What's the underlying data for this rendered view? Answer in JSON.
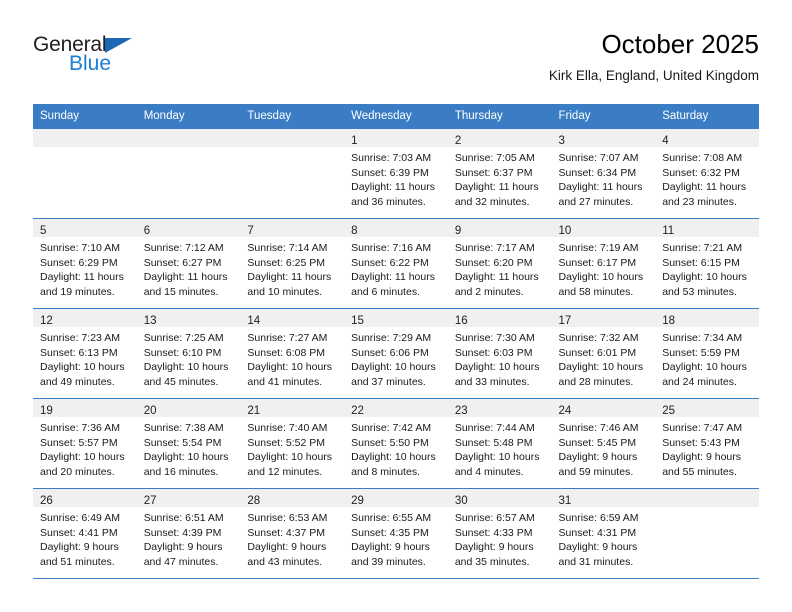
{
  "brand": {
    "name_top": "General",
    "name_bottom": "Blue",
    "accent_color": "#1b68b3",
    "blue_text_color": "#1b7fd4"
  },
  "header": {
    "title": "October 2025",
    "subtitle": "Kirk Ella, England, United Kingdom"
  },
  "theme": {
    "header_row_bg": "#3b7dc4",
    "header_row_text": "#ffffff",
    "daynum_band_bg": "#f0f0f0",
    "grid_line": "#3b7dc4"
  },
  "weekday_headers": [
    "Sunday",
    "Monday",
    "Tuesday",
    "Wednesday",
    "Thursday",
    "Friday",
    "Saturday"
  ],
  "weeks": [
    [
      {
        "day": "",
        "sunrise": "",
        "sunset": "",
        "daylight1": "",
        "daylight2": "",
        "empty": true
      },
      {
        "day": "",
        "sunrise": "",
        "sunset": "",
        "daylight1": "",
        "daylight2": "",
        "empty": true
      },
      {
        "day": "",
        "sunrise": "",
        "sunset": "",
        "daylight1": "",
        "daylight2": "",
        "empty": true
      },
      {
        "day": "1",
        "sunrise": "Sunrise: 7:03 AM",
        "sunset": "Sunset: 6:39 PM",
        "daylight1": "Daylight: 11 hours",
        "daylight2": "and 36 minutes.",
        "empty": false
      },
      {
        "day": "2",
        "sunrise": "Sunrise: 7:05 AM",
        "sunset": "Sunset: 6:37 PM",
        "daylight1": "Daylight: 11 hours",
        "daylight2": "and 32 minutes.",
        "empty": false
      },
      {
        "day": "3",
        "sunrise": "Sunrise: 7:07 AM",
        "sunset": "Sunset: 6:34 PM",
        "daylight1": "Daylight: 11 hours",
        "daylight2": "and 27 minutes.",
        "empty": false
      },
      {
        "day": "4",
        "sunrise": "Sunrise: 7:08 AM",
        "sunset": "Sunset: 6:32 PM",
        "daylight1": "Daylight: 11 hours",
        "daylight2": "and 23 minutes.",
        "empty": false
      }
    ],
    [
      {
        "day": "5",
        "sunrise": "Sunrise: 7:10 AM",
        "sunset": "Sunset: 6:29 PM",
        "daylight1": "Daylight: 11 hours",
        "daylight2": "and 19 minutes.",
        "empty": false
      },
      {
        "day": "6",
        "sunrise": "Sunrise: 7:12 AM",
        "sunset": "Sunset: 6:27 PM",
        "daylight1": "Daylight: 11 hours",
        "daylight2": "and 15 minutes.",
        "empty": false
      },
      {
        "day": "7",
        "sunrise": "Sunrise: 7:14 AM",
        "sunset": "Sunset: 6:25 PM",
        "daylight1": "Daylight: 11 hours",
        "daylight2": "and 10 minutes.",
        "empty": false
      },
      {
        "day": "8",
        "sunrise": "Sunrise: 7:16 AM",
        "sunset": "Sunset: 6:22 PM",
        "daylight1": "Daylight: 11 hours",
        "daylight2": "and 6 minutes.",
        "empty": false
      },
      {
        "day": "9",
        "sunrise": "Sunrise: 7:17 AM",
        "sunset": "Sunset: 6:20 PM",
        "daylight1": "Daylight: 11 hours",
        "daylight2": "and 2 minutes.",
        "empty": false
      },
      {
        "day": "10",
        "sunrise": "Sunrise: 7:19 AM",
        "sunset": "Sunset: 6:17 PM",
        "daylight1": "Daylight: 10 hours",
        "daylight2": "and 58 minutes.",
        "empty": false
      },
      {
        "day": "11",
        "sunrise": "Sunrise: 7:21 AM",
        "sunset": "Sunset: 6:15 PM",
        "daylight1": "Daylight: 10 hours",
        "daylight2": "and 53 minutes.",
        "empty": false
      }
    ],
    [
      {
        "day": "12",
        "sunrise": "Sunrise: 7:23 AM",
        "sunset": "Sunset: 6:13 PM",
        "daylight1": "Daylight: 10 hours",
        "daylight2": "and 49 minutes.",
        "empty": false
      },
      {
        "day": "13",
        "sunrise": "Sunrise: 7:25 AM",
        "sunset": "Sunset: 6:10 PM",
        "daylight1": "Daylight: 10 hours",
        "daylight2": "and 45 minutes.",
        "empty": false
      },
      {
        "day": "14",
        "sunrise": "Sunrise: 7:27 AM",
        "sunset": "Sunset: 6:08 PM",
        "daylight1": "Daylight: 10 hours",
        "daylight2": "and 41 minutes.",
        "empty": false
      },
      {
        "day": "15",
        "sunrise": "Sunrise: 7:29 AM",
        "sunset": "Sunset: 6:06 PM",
        "daylight1": "Daylight: 10 hours",
        "daylight2": "and 37 minutes.",
        "empty": false
      },
      {
        "day": "16",
        "sunrise": "Sunrise: 7:30 AM",
        "sunset": "Sunset: 6:03 PM",
        "daylight1": "Daylight: 10 hours",
        "daylight2": "and 33 minutes.",
        "empty": false
      },
      {
        "day": "17",
        "sunrise": "Sunrise: 7:32 AM",
        "sunset": "Sunset: 6:01 PM",
        "daylight1": "Daylight: 10 hours",
        "daylight2": "and 28 minutes.",
        "empty": false
      },
      {
        "day": "18",
        "sunrise": "Sunrise: 7:34 AM",
        "sunset": "Sunset: 5:59 PM",
        "daylight1": "Daylight: 10 hours",
        "daylight2": "and 24 minutes.",
        "empty": false
      }
    ],
    [
      {
        "day": "19",
        "sunrise": "Sunrise: 7:36 AM",
        "sunset": "Sunset: 5:57 PM",
        "daylight1": "Daylight: 10 hours",
        "daylight2": "and 20 minutes.",
        "empty": false
      },
      {
        "day": "20",
        "sunrise": "Sunrise: 7:38 AM",
        "sunset": "Sunset: 5:54 PM",
        "daylight1": "Daylight: 10 hours",
        "daylight2": "and 16 minutes.",
        "empty": false
      },
      {
        "day": "21",
        "sunrise": "Sunrise: 7:40 AM",
        "sunset": "Sunset: 5:52 PM",
        "daylight1": "Daylight: 10 hours",
        "daylight2": "and 12 minutes.",
        "empty": false
      },
      {
        "day": "22",
        "sunrise": "Sunrise: 7:42 AM",
        "sunset": "Sunset: 5:50 PM",
        "daylight1": "Daylight: 10 hours",
        "daylight2": "and 8 minutes.",
        "empty": false
      },
      {
        "day": "23",
        "sunrise": "Sunrise: 7:44 AM",
        "sunset": "Sunset: 5:48 PM",
        "daylight1": "Daylight: 10 hours",
        "daylight2": "and 4 minutes.",
        "empty": false
      },
      {
        "day": "24",
        "sunrise": "Sunrise: 7:46 AM",
        "sunset": "Sunset: 5:45 PM",
        "daylight1": "Daylight: 9 hours",
        "daylight2": "and 59 minutes.",
        "empty": false
      },
      {
        "day": "25",
        "sunrise": "Sunrise: 7:47 AM",
        "sunset": "Sunset: 5:43 PM",
        "daylight1": "Daylight: 9 hours",
        "daylight2": "and 55 minutes.",
        "empty": false
      }
    ],
    [
      {
        "day": "26",
        "sunrise": "Sunrise: 6:49 AM",
        "sunset": "Sunset: 4:41 PM",
        "daylight1": "Daylight: 9 hours",
        "daylight2": "and 51 minutes.",
        "empty": false
      },
      {
        "day": "27",
        "sunrise": "Sunrise: 6:51 AM",
        "sunset": "Sunset: 4:39 PM",
        "daylight1": "Daylight: 9 hours",
        "daylight2": "and 47 minutes.",
        "empty": false
      },
      {
        "day": "28",
        "sunrise": "Sunrise: 6:53 AM",
        "sunset": "Sunset: 4:37 PM",
        "daylight1": "Daylight: 9 hours",
        "daylight2": "and 43 minutes.",
        "empty": false
      },
      {
        "day": "29",
        "sunrise": "Sunrise: 6:55 AM",
        "sunset": "Sunset: 4:35 PM",
        "daylight1": "Daylight: 9 hours",
        "daylight2": "and 39 minutes.",
        "empty": false
      },
      {
        "day": "30",
        "sunrise": "Sunrise: 6:57 AM",
        "sunset": "Sunset: 4:33 PM",
        "daylight1": "Daylight: 9 hours",
        "daylight2": "and 35 minutes.",
        "empty": false
      },
      {
        "day": "31",
        "sunrise": "Sunrise: 6:59 AM",
        "sunset": "Sunset: 4:31 PM",
        "daylight1": "Daylight: 9 hours",
        "daylight2": "and 31 minutes.",
        "empty": false
      },
      {
        "day": "",
        "sunrise": "",
        "sunset": "",
        "daylight1": "",
        "daylight2": "",
        "empty": true
      }
    ]
  ]
}
